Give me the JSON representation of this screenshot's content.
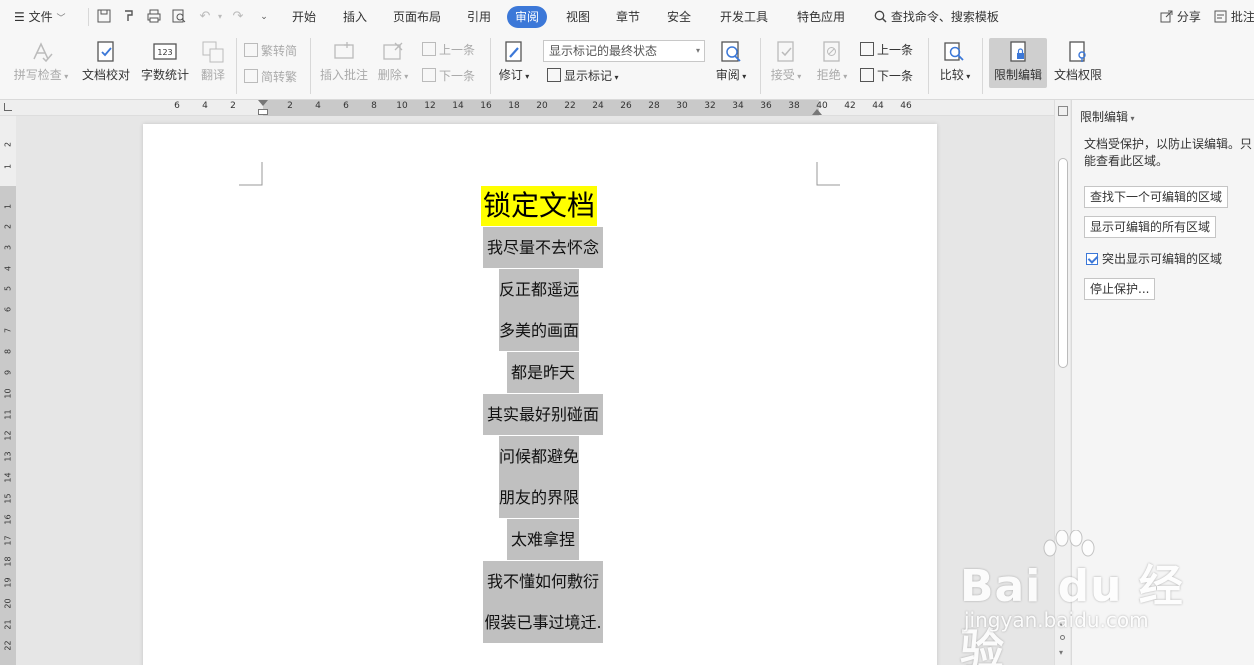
{
  "menubar": {
    "file": "文件",
    "tabs": [
      "开始",
      "插入",
      "页面布局",
      "引用",
      "审阅",
      "视图",
      "章节",
      "安全",
      "开发工具",
      "特色应用"
    ],
    "active_tab": "审阅",
    "search": "查找命令、搜索模板",
    "share": "分享",
    "comment": "批注"
  },
  "ribbon": {
    "spell_check": "拼写检查",
    "doc_proof": "文档校对",
    "word_count": "字数统计",
    "translate": "翻译",
    "trad_to_simp": "繁转简",
    "simp_to_trad": "简转繁",
    "insert_comment": "插入批注",
    "delete": "删除",
    "prev_comment": "上一条",
    "next_comment": "下一条",
    "revise": "修订",
    "display_mode": "显示标记的最终状态",
    "show_markup": "显示标记",
    "review": "审阅",
    "accept": "接受",
    "reject": "拒绝",
    "prev_change": "上一条",
    "next_change": "下一条",
    "compare": "比较",
    "restrict_edit": "限制编辑",
    "doc_permission": "文档权限"
  },
  "ruler": {
    "h_labels": [
      "6",
      "4",
      "2",
      "2",
      "4",
      "6",
      "8",
      "10",
      "12",
      "14",
      "16",
      "18",
      "20",
      "22",
      "24",
      "26",
      "28",
      "30",
      "32",
      "34",
      "36",
      "38",
      "40",
      "42",
      "44",
      "46"
    ],
    "v_labels": [
      "2",
      "1",
      "1",
      "2",
      "3",
      "4",
      "5",
      "6",
      "7",
      "8",
      "9",
      "10",
      "11",
      "12",
      "13",
      "14",
      "15",
      "16",
      "17",
      "18",
      "19",
      "20",
      "21",
      "22"
    ]
  },
  "document": {
    "title": "锁定文档",
    "lines": [
      "我尽量不去怀念",
      "反正都遥远",
      "多美的画面",
      "都是昨天",
      "其实最好别碰面",
      "问候都避免",
      "朋友的界限",
      "太难拿捏",
      "我不懂如何敷衍",
      "假装已事过境迁."
    ]
  },
  "panel": {
    "title": "限制编辑",
    "description": "文档受保护，以防止误编辑。只能查看此区域。",
    "find_next": "查找下一个可编辑的区域",
    "show_all": "显示可编辑的所有区域",
    "highlight": "突出显示可编辑的区域",
    "highlight_checked": true,
    "stop": "停止保护..."
  },
  "watermark": {
    "brand": "Bai du 经验",
    "url": "jingyan.baidu.com"
  },
  "colors": {
    "accent": "#3c78d8",
    "title_highlight": "#ffff00",
    "shading": "#c0c0c0"
  }
}
